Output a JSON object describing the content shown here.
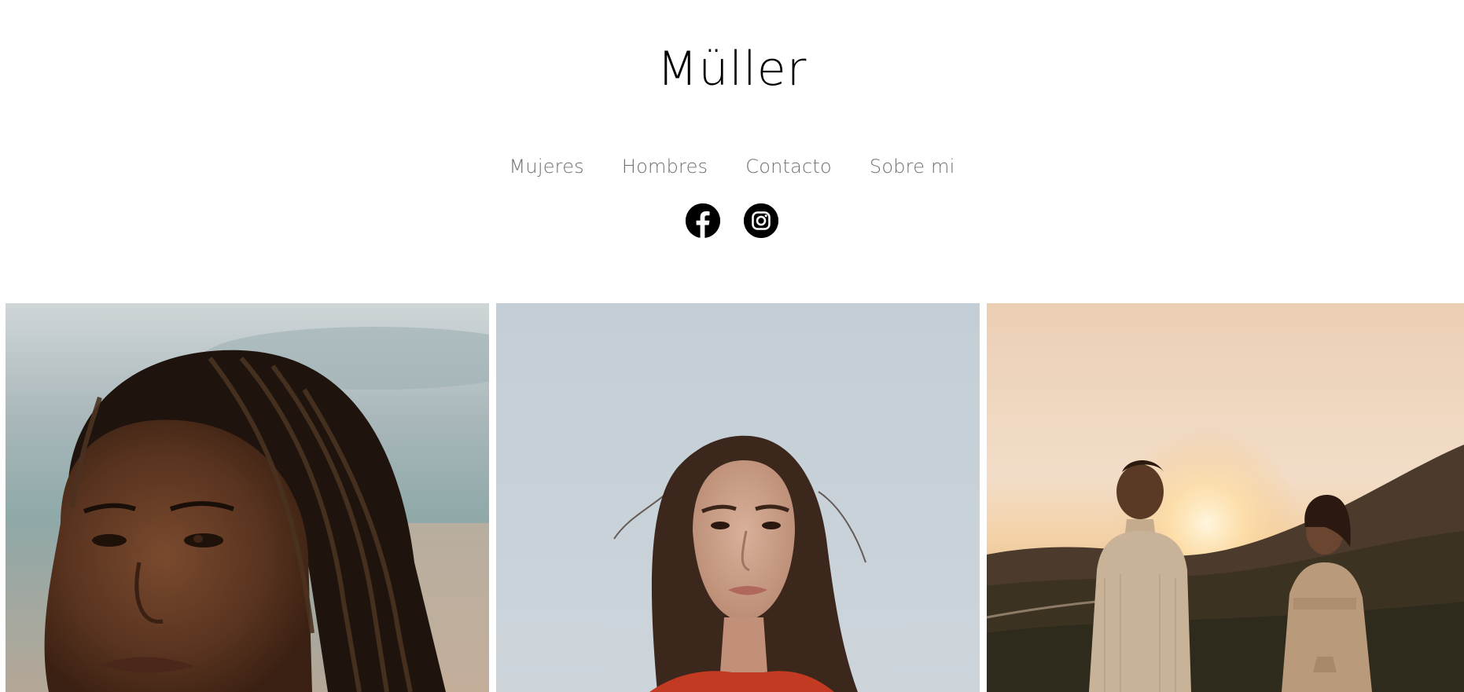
{
  "site": {
    "title": "Müller"
  },
  "nav": {
    "items": [
      "Mujeres",
      "Hombres",
      "Contacto",
      "Sobre mi"
    ]
  },
  "social": {
    "icons": [
      "facebook-icon",
      "instagram-icon"
    ]
  },
  "colors": {
    "background": "#ffffff",
    "title": "#000000",
    "nav_text": "#6f6f6f",
    "icon": "#000000"
  }
}
